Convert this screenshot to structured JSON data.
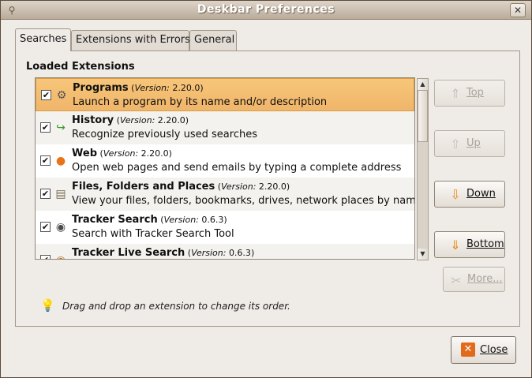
{
  "window": {
    "title": "Deskbar Preferences",
    "close_glyph": "✕"
  },
  "tabs": [
    {
      "label": "Searches",
      "active": true
    },
    {
      "label": "Extensions with Errors",
      "active": false
    },
    {
      "label": "General",
      "active": false
    }
  ],
  "searches": {
    "heading": "Loaded Extensions",
    "version_label": "Version:",
    "extensions": [
      {
        "name": "Programs",
        "version": "2.20.0",
        "description": "Launch a program by its name and/or description",
        "checked": true,
        "selected": true,
        "icon": "programs-icon",
        "glyph": "⚙"
      },
      {
        "name": "History",
        "version": "2.20.0",
        "description": "Recognize previously used searches",
        "checked": true,
        "selected": false,
        "icon": "history-arrow-icon",
        "glyph": "↪"
      },
      {
        "name": "Web",
        "version": "2.20.0",
        "description": "Open web pages and send emails by typing a complete address",
        "checked": true,
        "selected": false,
        "icon": "web-icon",
        "glyph": "●"
      },
      {
        "name": "Files, Folders and Places",
        "version": "2.20.0",
        "description": "View your files, folders, bookmarks, drives, network places by name",
        "checked": true,
        "selected": false,
        "icon": "files-icon",
        "glyph": "▤"
      },
      {
        "name": "Tracker Search",
        "version": "0.6.3",
        "description": "Search with Tracker Search Tool",
        "checked": true,
        "selected": false,
        "icon": "tracker-icon",
        "glyph": "◉"
      },
      {
        "name": "Tracker Live Search",
        "version": "0.6.3",
        "description": "",
        "checked": true,
        "selected": false,
        "icon": "tracker-live-icon",
        "glyph": "◉"
      }
    ],
    "buttons": {
      "top": "Top",
      "up": "Up",
      "down": "Down",
      "bottom": "Bottom",
      "more": "More..."
    },
    "hint": "Drag and drop an extension to change its order."
  },
  "footer": {
    "close_label": "Close"
  },
  "colors": {
    "selected_row": "#f0b56a",
    "accent_orange": "#e36a1b"
  }
}
